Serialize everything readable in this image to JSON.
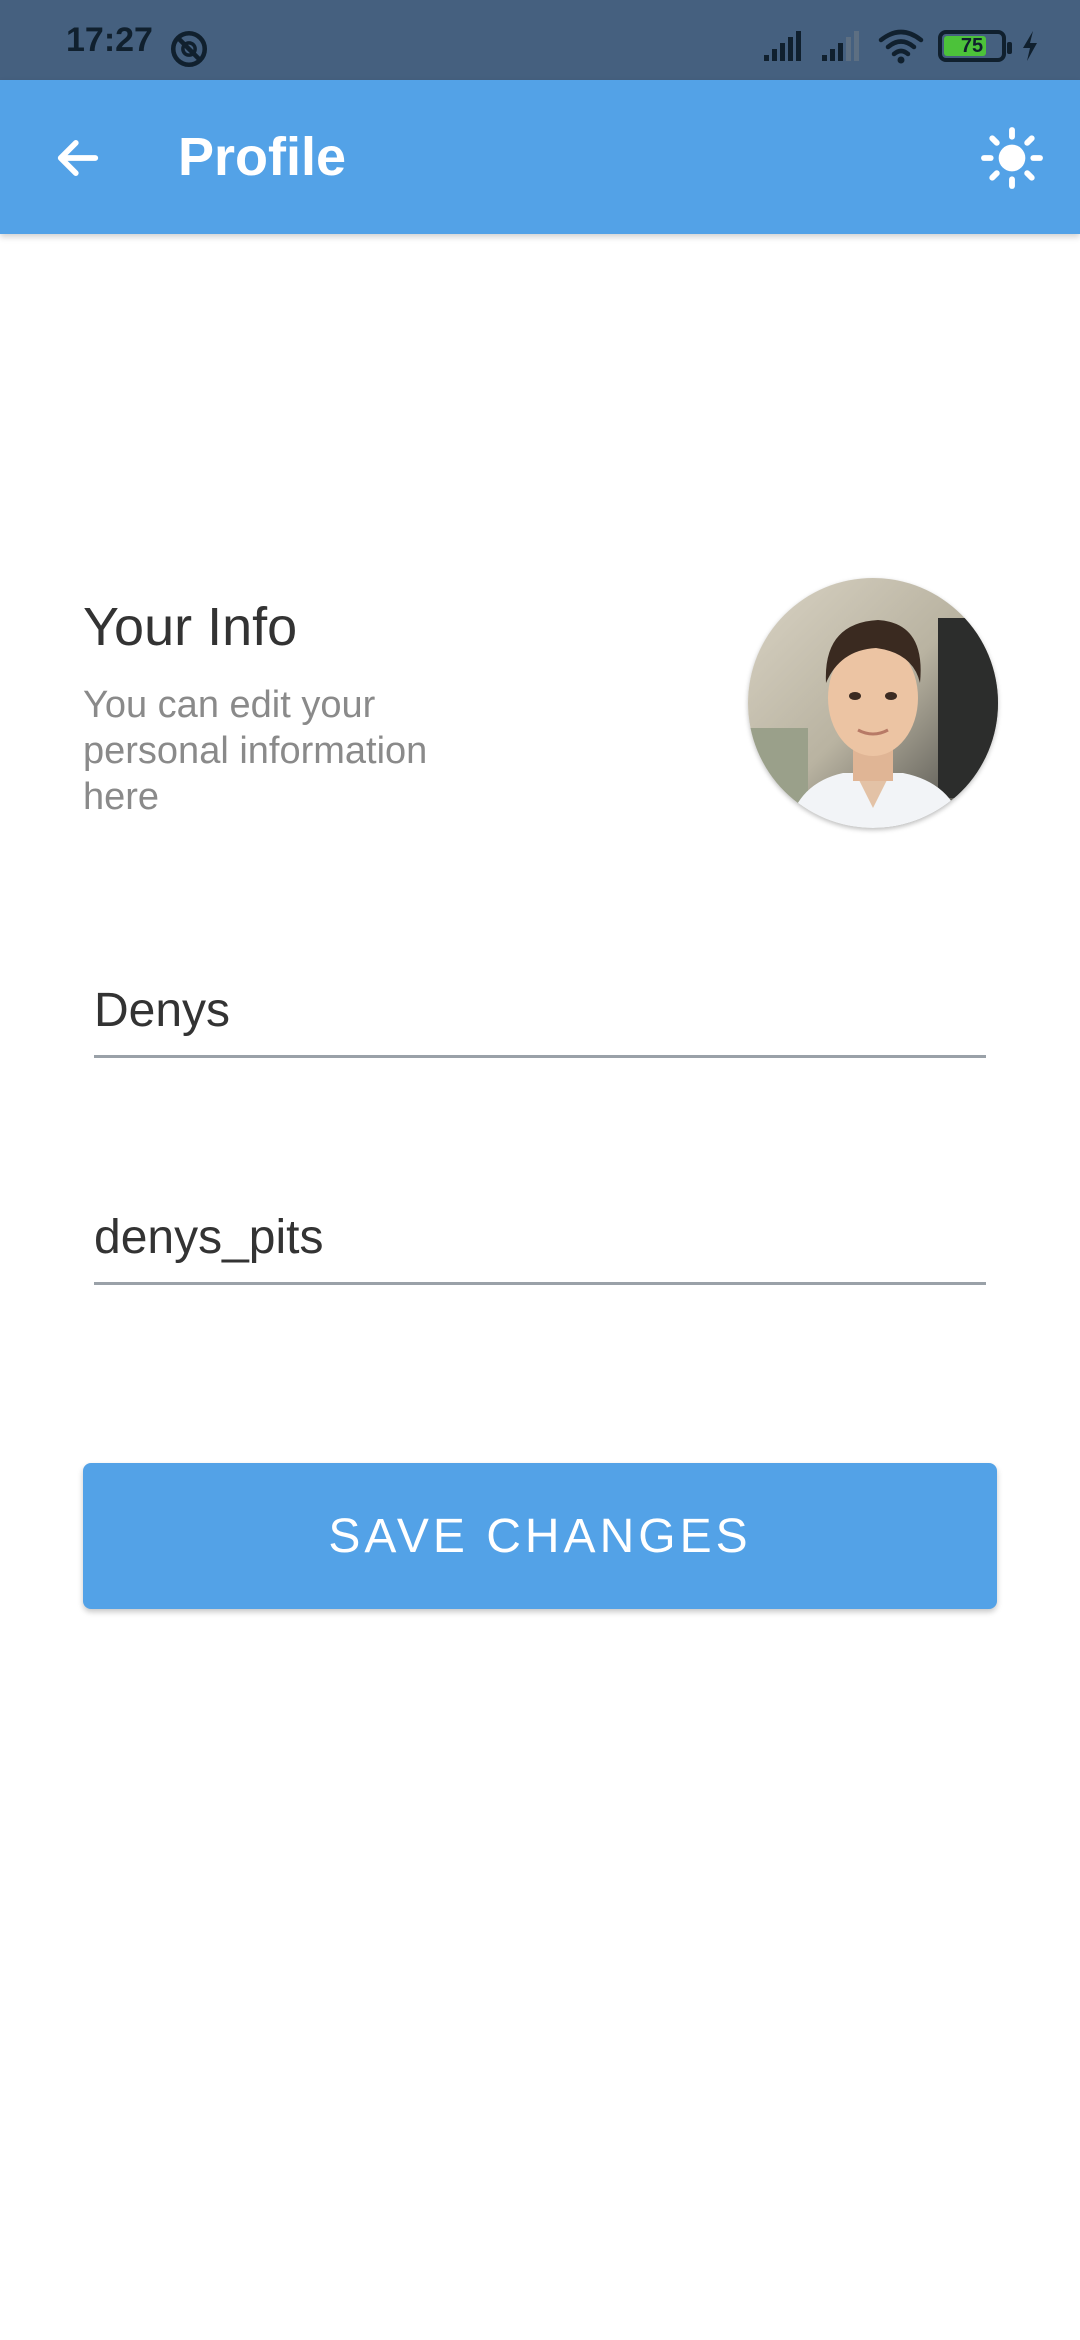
{
  "status_bar": {
    "time": "17:27",
    "battery_level": "75",
    "battery_fraction": 0.75,
    "icons": [
      "do-not-disturb-icon",
      "signal-icon",
      "signal-icon",
      "wifi-icon",
      "battery-icon",
      "charging-icon"
    ]
  },
  "app_bar": {
    "title": "Profile",
    "back_icon": "arrow-left-icon",
    "theme_icon": "sun-icon"
  },
  "info": {
    "title": "Your Info",
    "description": "You can edit your personal information here"
  },
  "form": {
    "name_value": "Denys",
    "username_value": "denys_pits"
  },
  "save_button": {
    "label": "SAVE CHANGES"
  },
  "colors": {
    "accent": "#53a2e7",
    "status_bar": "#45607f",
    "battery_fill": "#4cc23a"
  }
}
